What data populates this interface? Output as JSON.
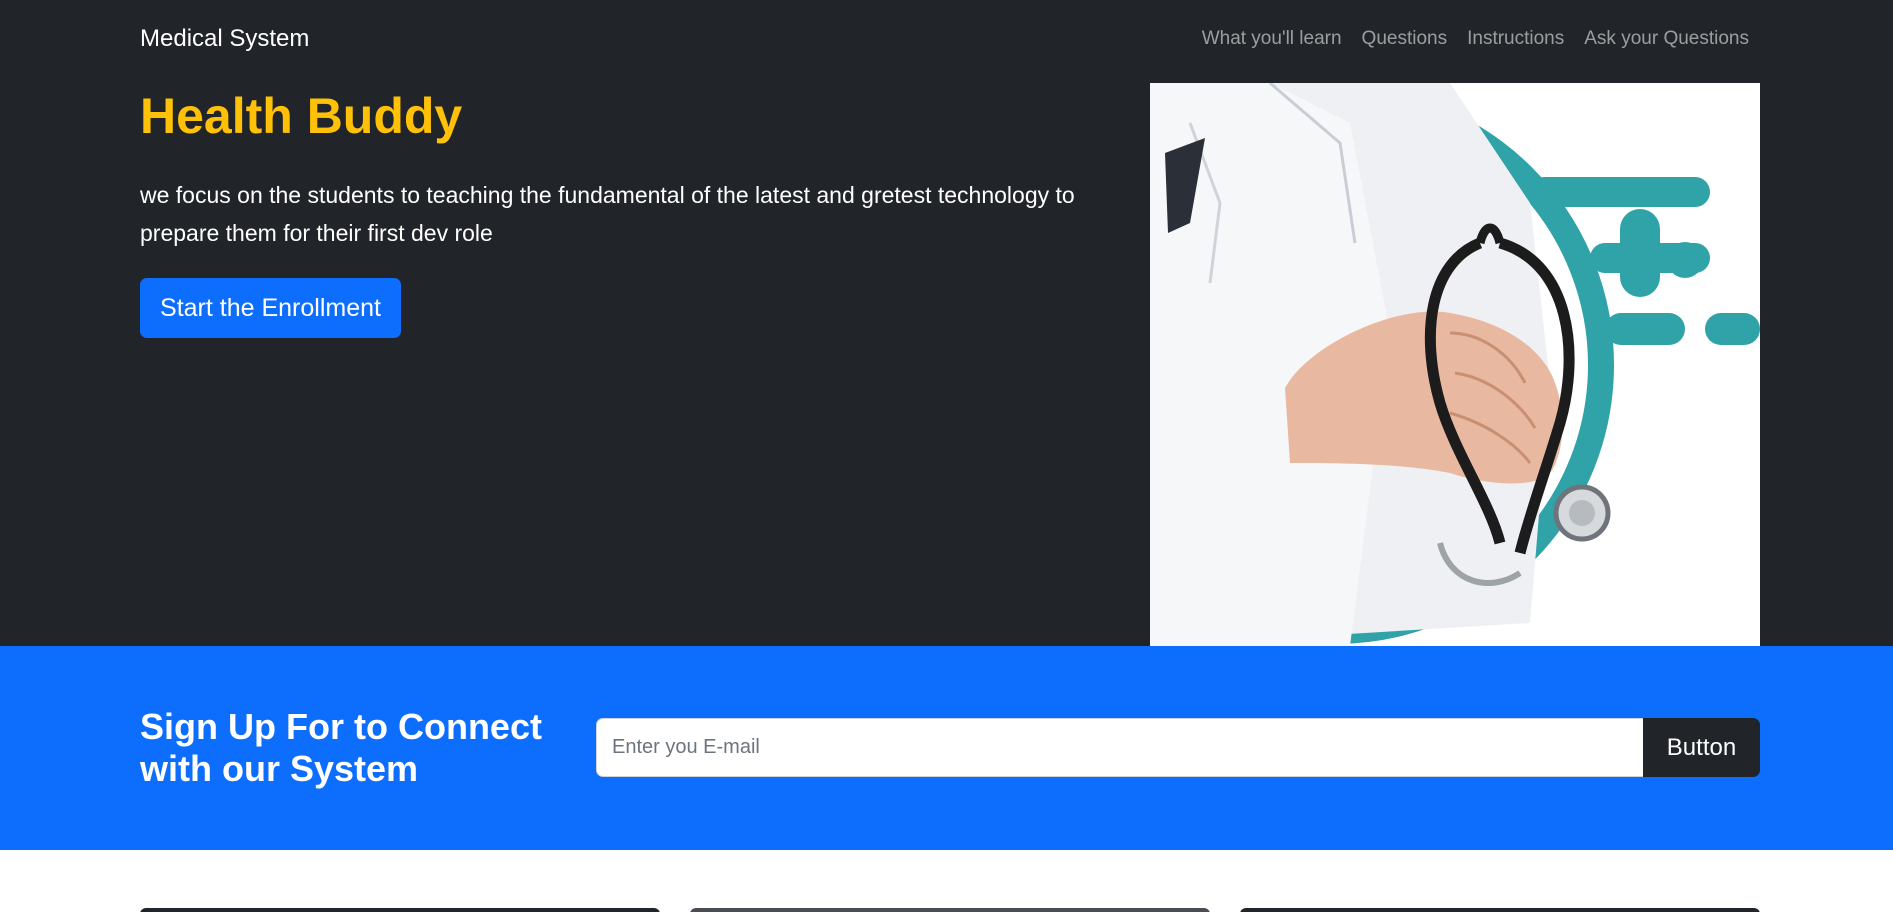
{
  "navbar": {
    "brand": "Medical System",
    "links": [
      {
        "label": "What you'll learn"
      },
      {
        "label": "Questions"
      },
      {
        "label": "Instructions"
      },
      {
        "label": "Ask your Questions"
      }
    ]
  },
  "hero": {
    "title": "Health Buddy",
    "description": "we focus on the students to teaching the fundamental of the latest and gretest technology to prepare them for their first dev role",
    "cta_label": "Start the Enrollment",
    "image_icon": "doctor-with-stethoscope"
  },
  "signup": {
    "title": "Sign Up For to Connect with our System",
    "email_placeholder": "Enter you E-mail",
    "email_value": "",
    "button_label": "Button"
  },
  "colors": {
    "dark": "#212529",
    "primary": "#0d6efd",
    "warning": "#ffc107",
    "teal": "#2fa3a8"
  }
}
